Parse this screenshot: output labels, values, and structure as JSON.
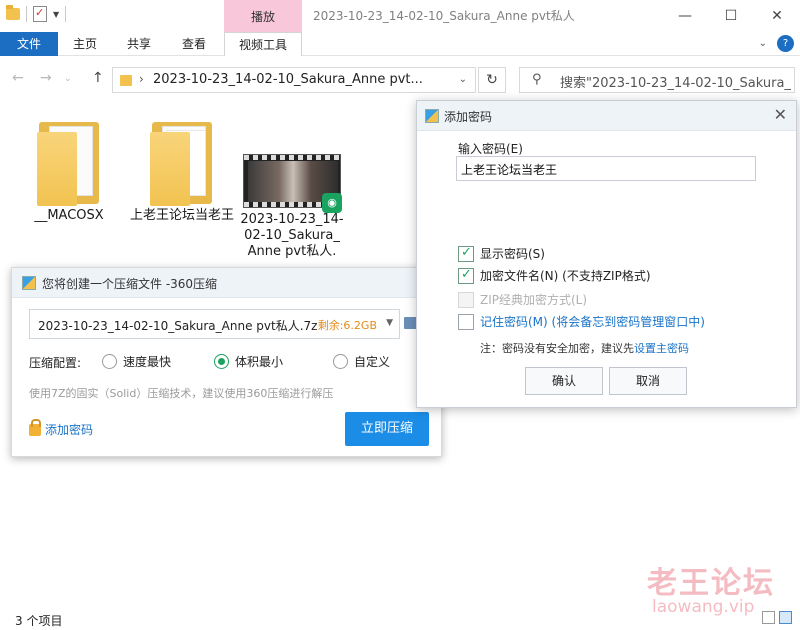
{
  "explorer": {
    "title": "2023-10-23_14-02-10_Sakura_Anne pvt私人",
    "play_tab": "播放",
    "tabs": {
      "file": "文件",
      "home": "主页",
      "share": "共享",
      "view": "查看",
      "video_tools": "视频工具"
    },
    "address": "2023-10-23_14-02-10_Sakura_Anne pvt...",
    "search_placeholder": "搜索\"2023-10-23_14-02-10_Sakura_...",
    "files": [
      {
        "name": "__MACOSX",
        "icon": "folder-icon"
      },
      {
        "name": "上老王论坛当老王",
        "icon": "folder-icon"
      },
      {
        "name": "2023-10-23_14-02-10_Sakura_Anne pvt私人.",
        "icon": "video-file-icon"
      }
    ],
    "status": "3 个项目"
  },
  "zip_dialog": {
    "title": "您将创建一个压缩文件 -360压缩",
    "filename": "2023-10-23_14-02-10_Sakura_Anne pvt私人.7z",
    "remaining": "剩余:6.2GB",
    "config_label": "压缩配置:",
    "options": [
      "速度最快",
      "体积最小",
      "自定义"
    ],
    "selected_option": "体积最小",
    "hint": "使用7Z的固实（Solid）压缩技术，建议使用360压缩进行解压",
    "add_password": "添加密码",
    "compress_now": "立即压缩",
    "accent": "#1b8de6"
  },
  "password_dialog": {
    "title": "添加密码",
    "input_label": "输入密码(E)",
    "password_value": "上老王论坛当老王",
    "show_password": {
      "label": "显示密码(S)",
      "checked": true
    },
    "encrypt_filenames": {
      "label": "加密文件名(N) (不支持ZIP格式)",
      "checked": true
    },
    "zip_classic": {
      "label": "ZIP经典加密方式(L)",
      "checked": false,
      "disabled": true
    },
    "remember": {
      "label": "记住密码(M) (将会备忘到密码管理窗口中)",
      "checked": false
    },
    "note_prefix": "注：密码没有安全加密，建议先",
    "note_link": "设置主密码",
    "ok": "确认",
    "cancel": "取消"
  },
  "watermark": {
    "text": "老王论坛",
    "url": "laowang.vip"
  }
}
